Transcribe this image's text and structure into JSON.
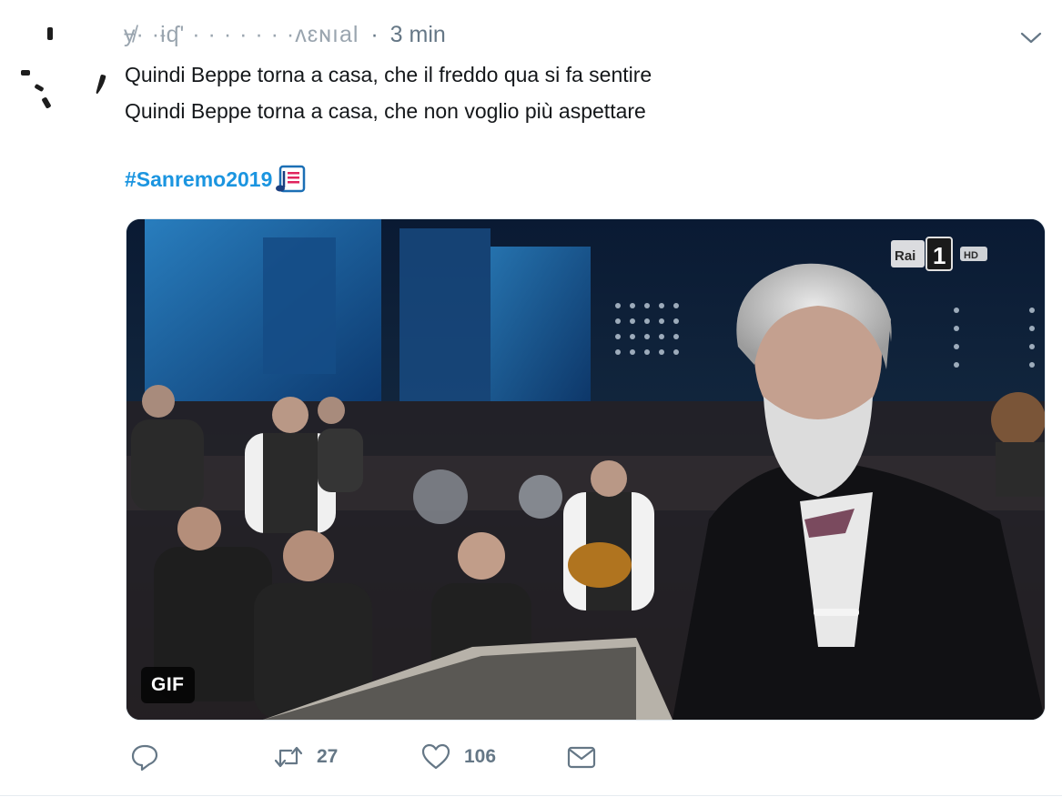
{
  "tweet": {
    "author_name": "ɏ̸·  ·ɨʠ'  ·   ·   ·   ·  ·  ·  ·ʌɛɴıal",
    "separator": "·",
    "timestamp": "3 min",
    "lines": [
      "Quindi Beppe torna a casa, che il freddo qua si fa sentire",
      "Quindi Beppe torna a casa, che non voglio più aspettare"
    ],
    "hashtag": "#Sanremo2019",
    "hashtag_emoji": "musical-score-emoji",
    "media": {
      "type": "gif",
      "badge_label": "GIF",
      "channel_logo_text": "Rai",
      "channel_number": "1",
      "channel_hd": "HD"
    }
  },
  "actions": {
    "reply": {
      "icon": "reply-icon",
      "count": ""
    },
    "retweet": {
      "icon": "retweet-icon",
      "count": "27"
    },
    "like": {
      "icon": "heart-icon",
      "count": "106"
    },
    "dm": {
      "icon": "envelope-icon"
    }
  },
  "colors": {
    "text": "#14171a",
    "muted": "#657786",
    "link": "#1b95e0",
    "border": "#e1e8ed"
  }
}
